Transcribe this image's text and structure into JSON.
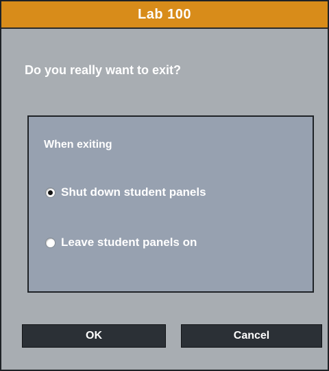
{
  "window": {
    "title": "Lab 100",
    "title_bar_color": "#d88c1a",
    "background_color": "#a8adb2"
  },
  "dialog": {
    "question": "Do you really want to exit?",
    "group": {
      "label": "When exiting",
      "options": [
        {
          "label": "Shut down student panels",
          "selected": true
        },
        {
          "label": "Leave student panels on",
          "selected": false
        }
      ]
    }
  },
  "buttons": {
    "ok_label": "OK",
    "cancel_label": "Cancel"
  }
}
